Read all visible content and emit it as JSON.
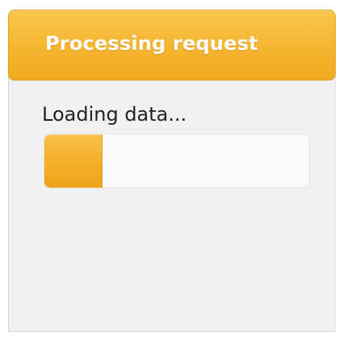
{
  "dialog": {
    "title": "Processing request",
    "accent_color": "#f5b52f"
  },
  "progress": {
    "label": "Loading data...",
    "percent": 22
  }
}
